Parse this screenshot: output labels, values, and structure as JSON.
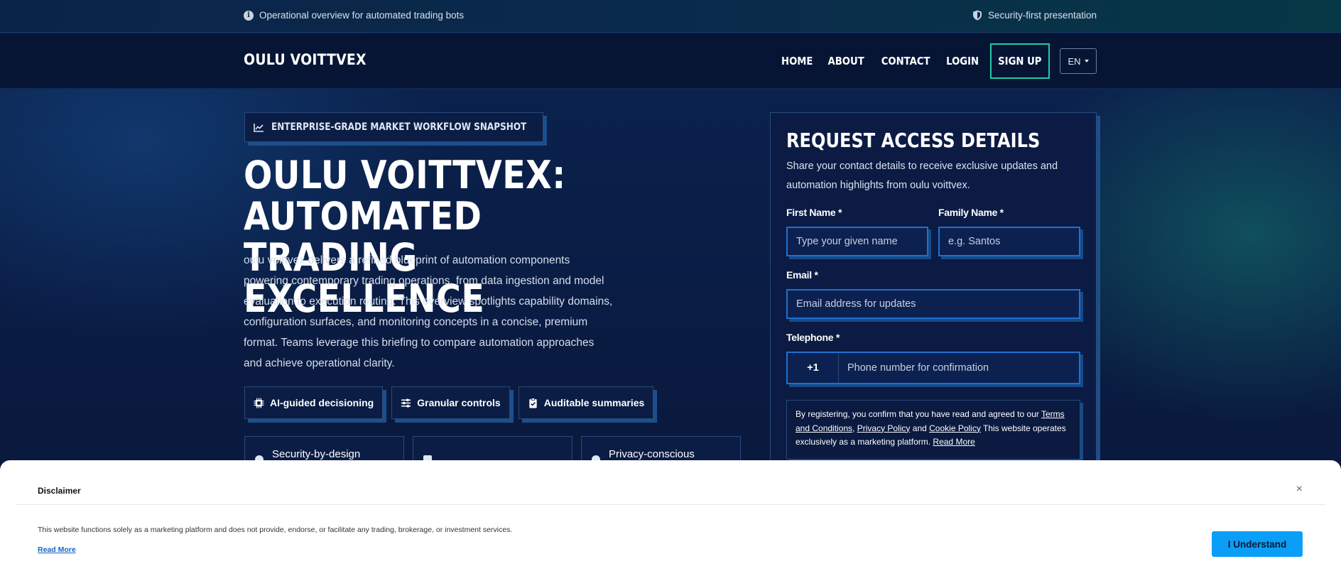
{
  "topbar": {
    "left_text": "Operational overview for automated trading bots",
    "left_icon": "info-icon",
    "right_text": "Security-first presentation",
    "right_icon": "shield-icon"
  },
  "nav": {
    "brand": "OULU VOITTVEX",
    "links": [
      "HOME",
      "ABOUT",
      "CONTACT",
      "LOGIN"
    ],
    "signup": "SIGN UP",
    "language": "EN"
  },
  "hero": {
    "badge": "ENTERPRISE-GRADE MARKET WORKFLOW SNAPSHOT",
    "title": "OULU VOITTVEX: AUTOMATED TRADING EXCELLENCE",
    "description": "oulu voittvex delivers a refined blueprint of automation components powering contemporary trading operations, from data ingestion and model evaluation to execution routing. This overview spotlights capability domains, configuration surfaces, and monitoring concepts in a concise, premium format. Teams leverage this briefing to compare automation approaches and achieve operational clarity.",
    "chips": [
      {
        "label": "AI-guided decisioning",
        "icon": "chip-icon"
      },
      {
        "label": "Granular controls",
        "icon": "sliders-icon"
      },
      {
        "label": "Auditable summaries",
        "icon": "clipboard-check-icon"
      }
    ],
    "cards": [
      {
        "label": "Security-by-design"
      },
      {
        "label": ""
      },
      {
        "label": "Privacy-conscious"
      }
    ]
  },
  "form": {
    "title": "REQUEST ACCESS DETAILS",
    "subtitle": "Share your contact details to receive exclusive updates and automation highlights from oulu voittvex.",
    "first_name_label": "First Name *",
    "first_name_placeholder": "Type your given name",
    "family_name_label": "Family Name *",
    "family_name_placeholder": "e.g. Santos",
    "email_label": "Email *",
    "email_placeholder": "Email address for updates",
    "telephone_label": "Telephone *",
    "phone_code": "+1",
    "phone_placeholder": "Phone number for confirmation",
    "consent": {
      "prefix": "By registering, you confirm that you have read and agreed to our",
      "terms": "Terms and Conditions",
      "privacy": "Privacy Policy",
      "and": "and",
      "cookie": "Cookie Policy",
      "suffix": "This website operates exclusively as a marketing platform.",
      "read_more": "Read More"
    }
  },
  "disclaimer": {
    "title": "Disclaimer",
    "close": "×",
    "text": "This website functions solely as a marketing platform and does not provide, endorse, or facilitate any trading, brokerage, or investment services.",
    "read_more": "Read More",
    "button": "I Understand"
  },
  "colors": {
    "accent_teal": "#22c9a8",
    "input_border": "#1e6fd0",
    "cta_blue": "#0b9ef7",
    "panel_bg": "#0b1b44"
  }
}
